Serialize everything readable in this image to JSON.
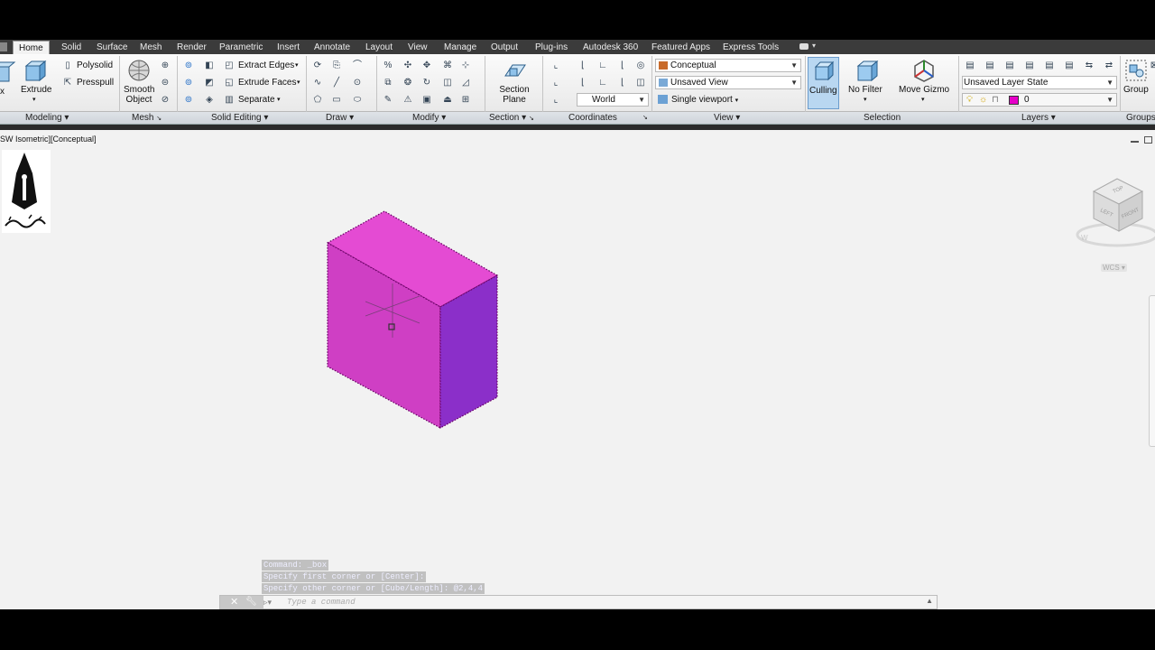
{
  "tabs": [
    "Home",
    "Solid",
    "Surface",
    "Mesh",
    "Render",
    "Parametric",
    "Insert",
    "Annotate",
    "Layout",
    "View",
    "Manage",
    "Output",
    "Plug-ins",
    "Autodesk 360",
    "Featured Apps",
    "Express Tools"
  ],
  "active_tab": "Home",
  "ribbon": {
    "modeling": {
      "box_label": "x",
      "extrude_label": "Extrude",
      "polysolid": "Polysolid",
      "presspull": "Presspull"
    },
    "mesh": {
      "smooth_object": "Smooth Object"
    },
    "solid_editing": {
      "extract_edges": "Extract Edges",
      "extrude_faces": "Extrude Faces",
      "separate": "Separate"
    },
    "section": {
      "section_plane": "Section Plane"
    },
    "coordinates": {
      "world": "World"
    },
    "view": {
      "visual_style": "Conceptual",
      "saved_view": "Unsaved View",
      "viewport_config": "Single viewport"
    },
    "selection": {
      "culling": "Culling",
      "no_filter": "No Filter",
      "move_gizmo": "Move Gizmo"
    },
    "layers": {
      "layer_state": "Unsaved Layer State",
      "current_layer": "0",
      "layer_color": "#e600c8"
    },
    "groups": {
      "group": "Group"
    }
  },
  "panels": [
    "Modeling",
    "Mesh",
    "Solid Editing",
    "Draw",
    "Modify",
    "Section",
    "Coordinates",
    "View",
    "Selection",
    "Layers",
    "Groups"
  ],
  "viewport": {
    "label": "SW Isometric][Conceptual]",
    "viewcube": {
      "top": "TOP",
      "left": "LEFT",
      "front": "FRONT"
    },
    "ucs": "WCS",
    "compass": "W",
    "box_colors": {
      "top": "#e44bd3",
      "front": "#cf3fc4",
      "side": "#8b2fc9"
    }
  },
  "command": {
    "history": [
      "Command: _box",
      "Specify first corner or [Center]:",
      "Specify other corner or [Cube/Length]: @2,4,4"
    ],
    "placeholder": "Type a command"
  }
}
